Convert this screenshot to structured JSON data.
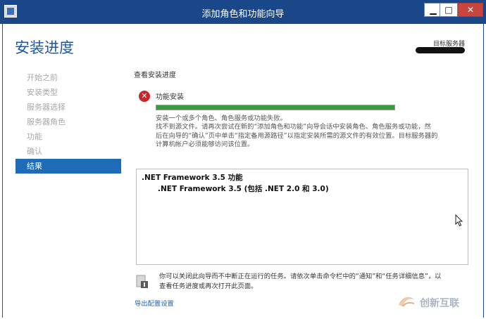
{
  "window": {
    "title": "添加角色和功能向导",
    "minimize_label": "▁",
    "maximize_label": "□",
    "close_label": "✕"
  },
  "header": {
    "page_title": "安装进度",
    "destination_label": "目标服务器"
  },
  "sidebar": {
    "items": [
      {
        "label": "开始之前",
        "active": false
      },
      {
        "label": "安装类型",
        "active": false
      },
      {
        "label": "服务器选择",
        "active": false
      },
      {
        "label": "服务器角色",
        "active": false
      },
      {
        "label": "功能",
        "active": false
      },
      {
        "label": "确认",
        "active": false
      },
      {
        "label": "结果",
        "active": true
      }
    ]
  },
  "main": {
    "section_label": "查看安装进度",
    "status_title": "功能安装",
    "progress_fraction": 1.0,
    "message_line1": "安装一个或多个角色、角色服务或功能失败。",
    "message_line2": "找不到源文件。请再次尝试在新的“添加角色和功能”向导会话中安装角色、角色服务或功能，然",
    "message_line3": "后在向导的“确认”页中单击“指定备用源路径”以指定安装所需的源文件的有效位置。目标服务器的",
    "message_line4": "计算机帐户必须能够访问该位置。",
    "results": {
      "item": ".NET Framework 3.5 功能",
      "subitem": ".NET Framework 3.5 (包括 .NET 2.0 和 3.0)"
    },
    "note_line1": "你可以关闭此向导而不中断正在运行的任务。请依次单击命令栏中的“通知”和“任务详细信息”，以",
    "note_line2": "查看任务进度或再次打开此页面。",
    "export_link": "导出配置设置"
  },
  "watermark": {
    "text": "创新互联"
  },
  "colors": {
    "titlebar": "#19478a",
    "accent": "#1b56a4",
    "active_nav": "#1e6bb8",
    "error": "#c8252c",
    "progress_fill": "#3c9b3c"
  }
}
